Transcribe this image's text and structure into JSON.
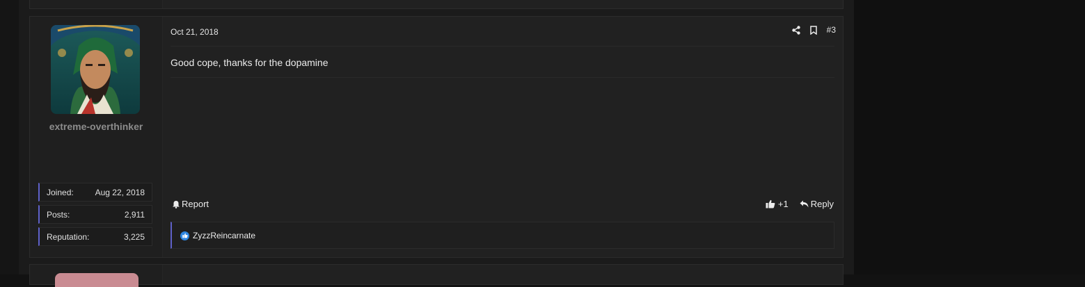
{
  "post": {
    "date": "Oct 21, 2018",
    "number": "#3",
    "message": "Good cope, thanks for the dopamine",
    "icons": {
      "share": "share-icon",
      "bookmark": "bookmark-icon"
    },
    "footer": {
      "report_label": "Report",
      "like_count": "+1",
      "reply_label": "Reply"
    },
    "reactions": {
      "users": "ZyzzReincarnate"
    }
  },
  "user": {
    "username": "extreme-overthinker",
    "stats": [
      {
        "label": "Joined:",
        "value": "Aug 22, 2018"
      },
      {
        "label": "Posts:",
        "value": "2,911"
      },
      {
        "label": "Reputation:",
        "value": "3,225"
      }
    ]
  },
  "colors": {
    "accent": "#5f61c9",
    "like": "#2f86e0",
    "username": "#8c8c8c"
  }
}
